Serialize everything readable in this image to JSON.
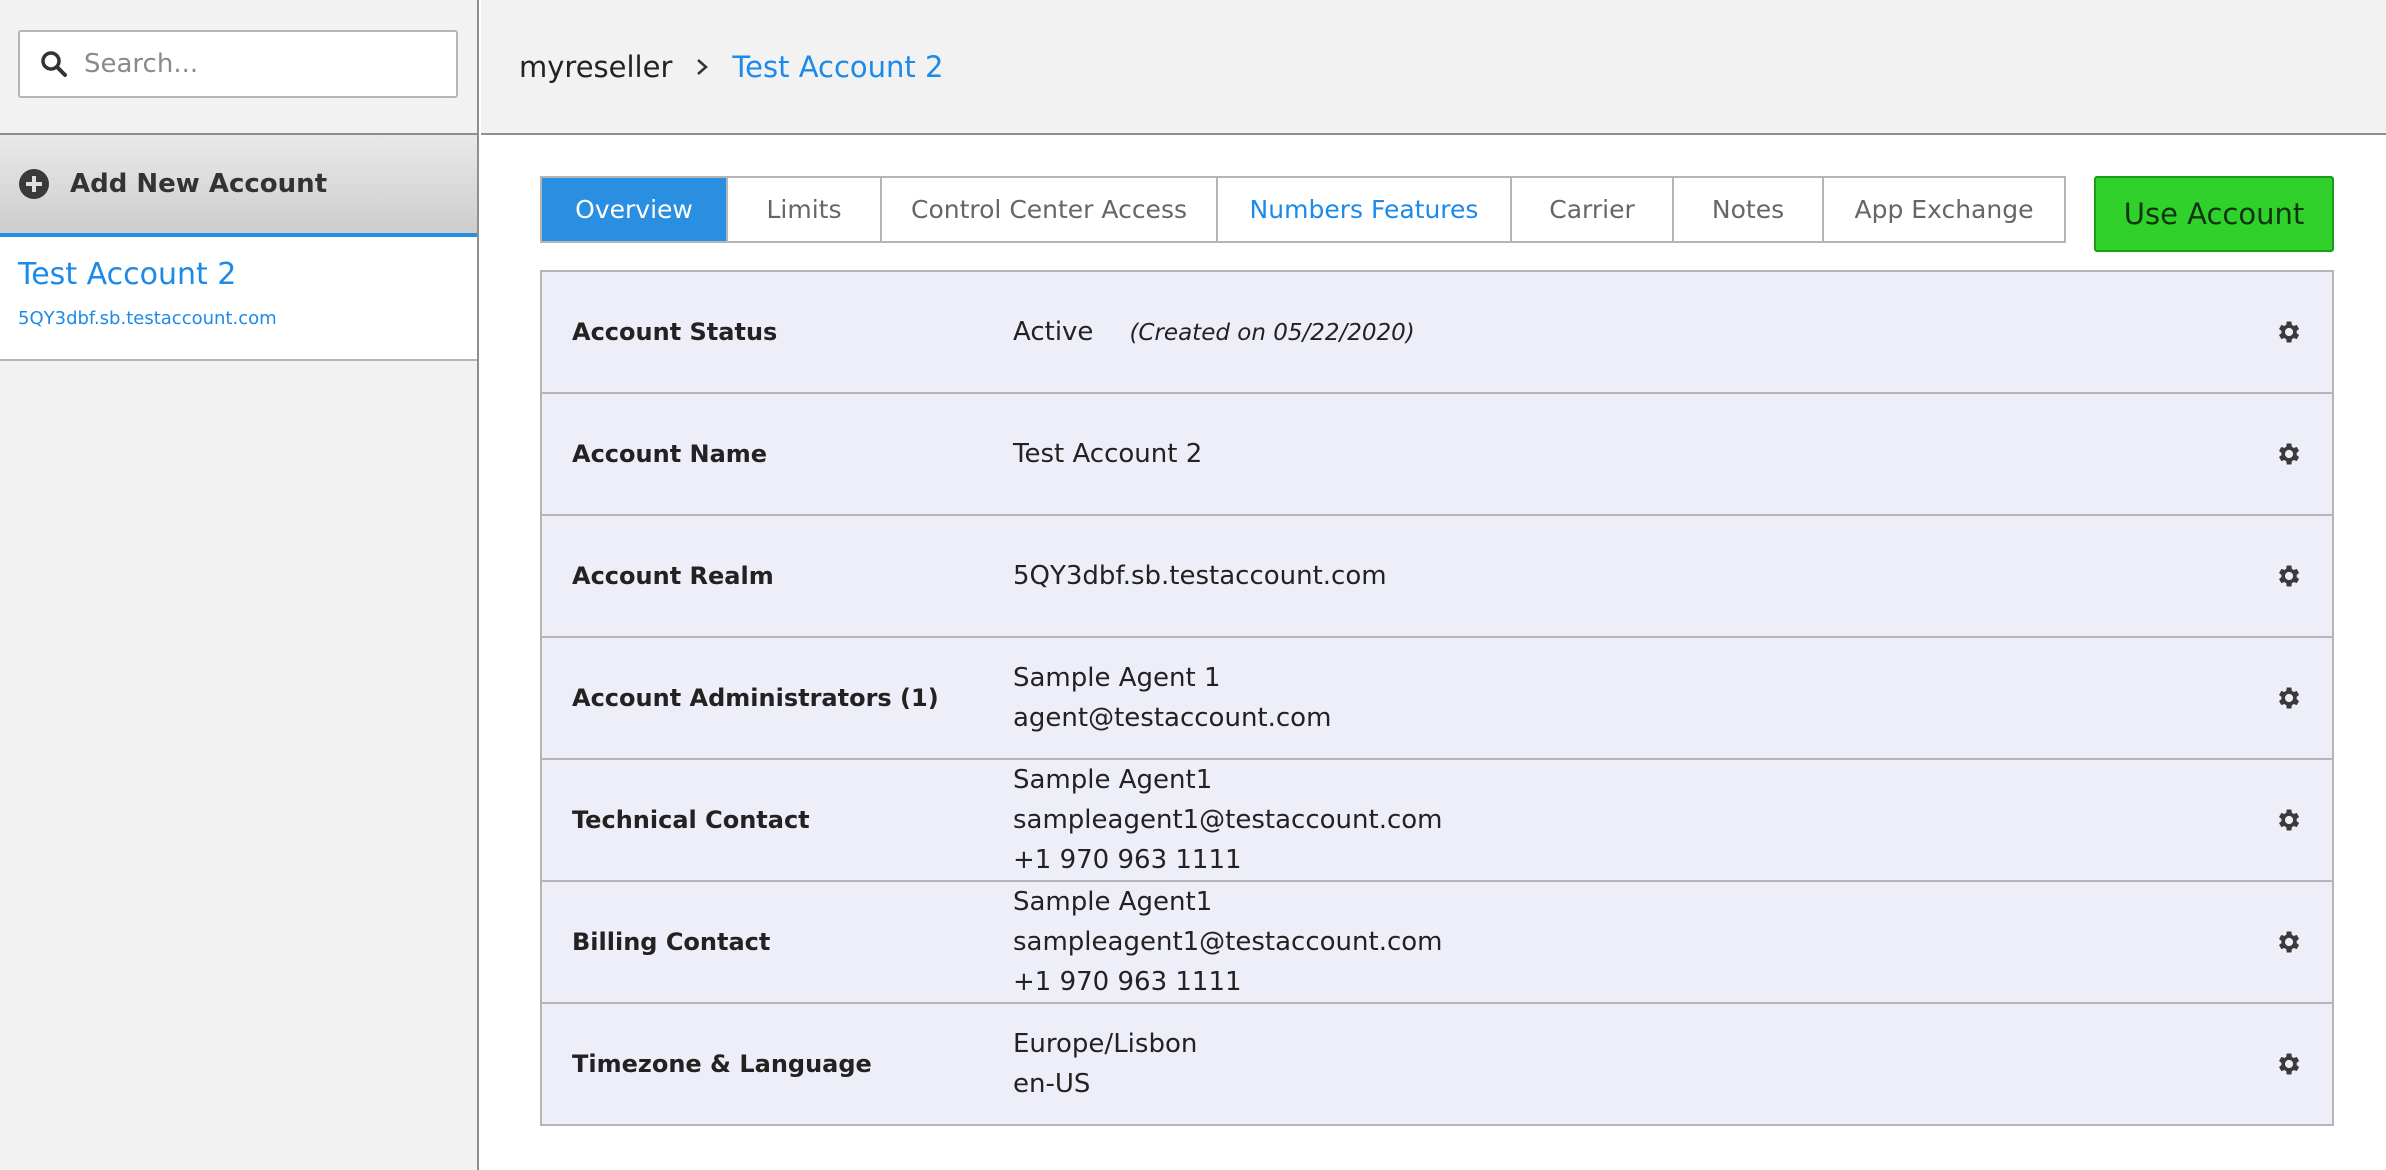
{
  "search": {
    "placeholder": "Search..."
  },
  "sidebar": {
    "add_label": "Add New Account",
    "accounts": [
      {
        "name": "Test Account 2",
        "realm": "5QY3dbf.sb.testaccount.com"
      }
    ]
  },
  "breadcrumb": {
    "root": "myreseller",
    "current": "Test Account 2"
  },
  "tabs": [
    {
      "label": "Overview",
      "state": "active"
    },
    {
      "label": "Limits",
      "state": "normal"
    },
    {
      "label": "Control Center Access",
      "state": "normal"
    },
    {
      "label": "Numbers Features",
      "state": "highlight"
    },
    {
      "label": "Carrier",
      "state": "normal"
    },
    {
      "label": "Notes",
      "state": "normal"
    },
    {
      "label": "App Exchange",
      "state": "normal"
    }
  ],
  "use_account_label": "Use Account",
  "details": {
    "status": {
      "label": "Account Status",
      "value": "Active",
      "created": "(Created on 05/22/2020)"
    },
    "name": {
      "label": "Account Name",
      "value": "Test Account 2"
    },
    "realm": {
      "label": "Account Realm",
      "value": "5QY3dbf.sb.testaccount.com"
    },
    "admins": {
      "label": "Account Administrators (1)",
      "name": "Sample Agent 1",
      "email": "agent@testaccount.com"
    },
    "technical": {
      "label": "Technical Contact",
      "name": "Sample Agent1",
      "email": "sampleagent1@testaccount.com",
      "phone": "+1 970 963 1111"
    },
    "billing": {
      "label": "Billing Contact",
      "name": "Sample Agent1",
      "email": "sampleagent1@testaccount.com",
      "phone": "+1 970 963 1111"
    },
    "timezone": {
      "label": "Timezone & Language",
      "timezone": "Europe/Lisbon",
      "language": "en-US"
    }
  },
  "colors": {
    "accent": "#2a8fe0",
    "link": "#1b8ae8",
    "use_account_bg": "#2fd12a",
    "row_bg": "#edeef8"
  }
}
